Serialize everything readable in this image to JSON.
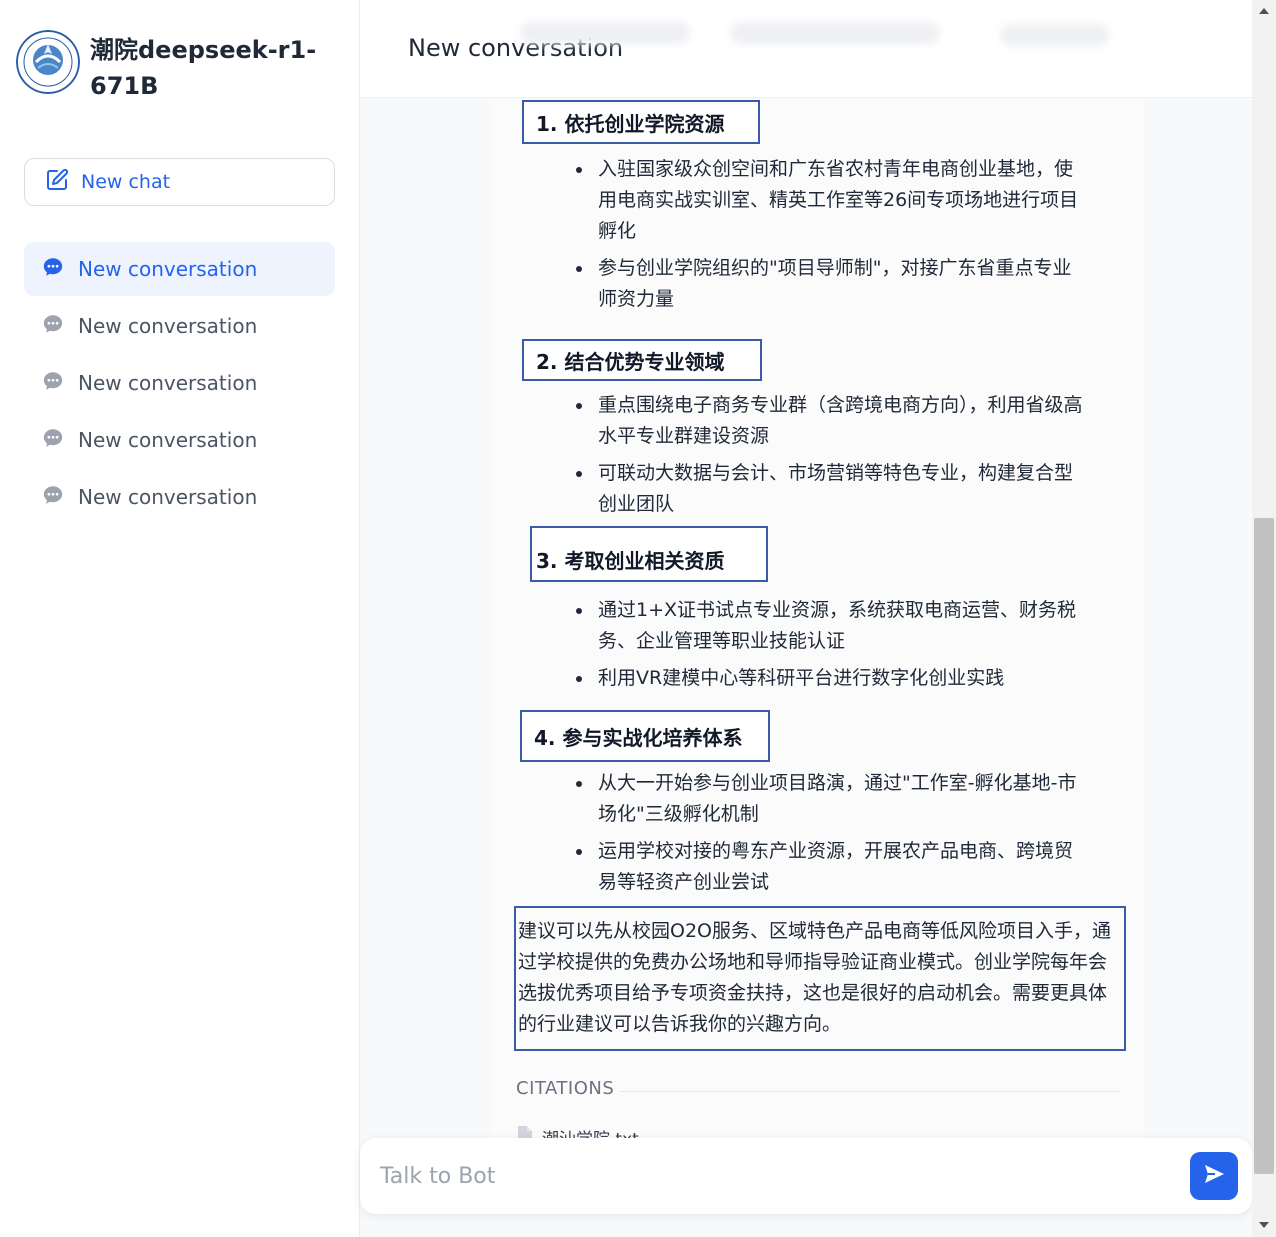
{
  "sidebar": {
    "brand_title": "潮院deepseek-r1-671B",
    "new_chat_label": "New chat",
    "conversations": [
      {
        "label": "New conversation",
        "active": true
      },
      {
        "label": "New conversation",
        "active": false
      },
      {
        "label": "New conversation",
        "active": false
      },
      {
        "label": "New conversation",
        "active": false
      },
      {
        "label": "New conversation",
        "active": false
      }
    ]
  },
  "header": {
    "title": "New conversation"
  },
  "message": {
    "sections": [
      {
        "heading": "1. 依托创业学院资源",
        "bullets": [
          "入驻国家级众创空间和广东省农村青年电商创业基地，使用电商实战实训室、精英工作室等26间专项场地进行项目孵化",
          "参与创业学院组织的\"项目导师制\"，对接广东省重点专业师资力量"
        ]
      },
      {
        "heading": "2. 结合优势专业领域",
        "bullets": [
          "重点围绕电子商务专业群（含跨境电商方向），利用省级高水平专业群建设资源",
          "可联动大数据与会计、市场营销等特色专业，构建复合型创业团队"
        ]
      },
      {
        "heading": "3. 考取创业相关资质",
        "bullets": [
          "通过1+X证书试点专业资源，系统获取电商运营、财务税务、企业管理等职业技能认证",
          "利用VR建模中心等科研平台进行数字化创业实践"
        ]
      },
      {
        "heading": "4. 参与实战化培养体系",
        "bullets": [
          "从大一开始参与创业项目路演，通过\"工作室-孵化基地-市场化\"三级孵化机制",
          "运用学校对接的粤东产业资源，开展农产品电商、跨境贸易等轻资产创业尝试"
        ]
      }
    ],
    "summary": "建议可以先从校园O2O服务、区域特色产品电商等低风险项目入手，通过学校提供的免费办公场地和导师指导验证商业模式。创业学院每年会选拔优秀项目给予专项资金扶持，这也是很好的启动机会。需要更具体的行业建议可以告诉我你的兴趣方向。",
    "citations_label": "CITATIONS",
    "citation_file": "潮汕学院.txt"
  },
  "input": {
    "placeholder": "Talk to Bot"
  },
  "colors": {
    "accent": "#2563eb",
    "annotation_box": "#3b5aa8"
  }
}
